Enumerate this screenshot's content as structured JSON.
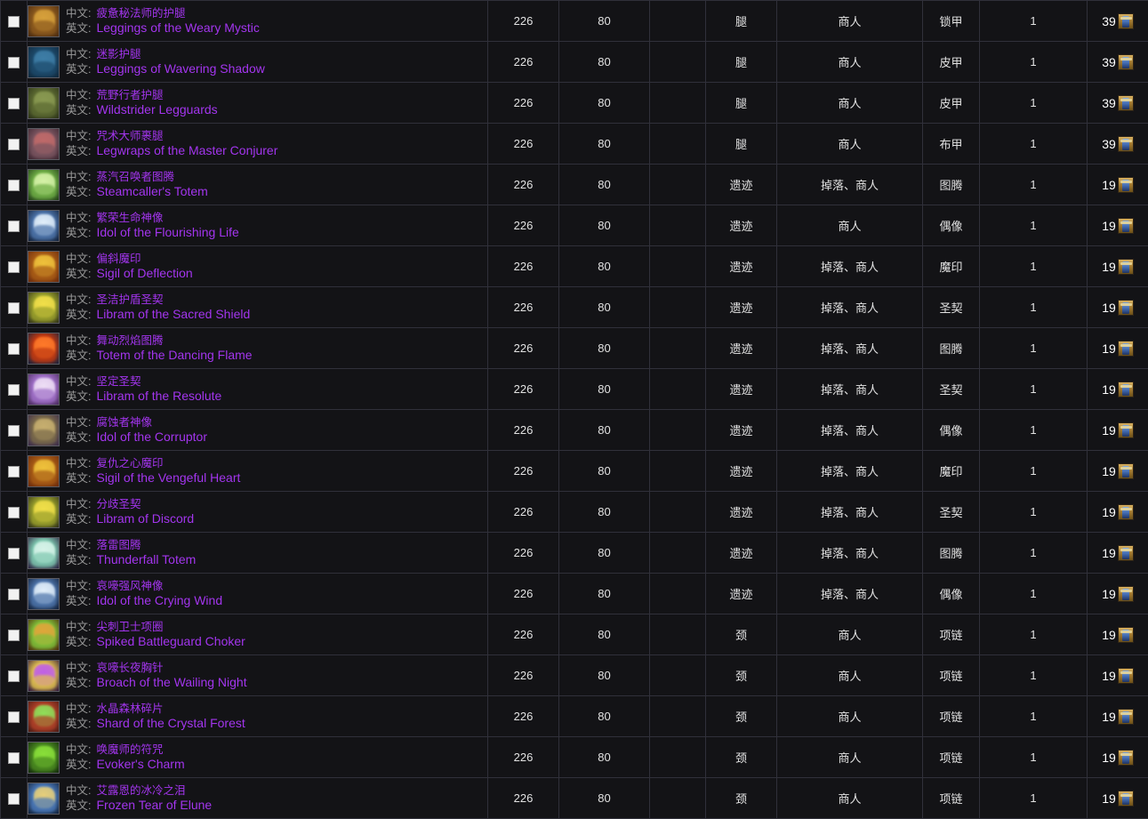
{
  "table": {
    "lang_labels": {
      "cn": "中文:",
      "en": "英文:"
    },
    "icon_names": {
      "checkbox": "row-checkbox",
      "item": "item-icon",
      "token": "emblem-token-icon"
    },
    "colors": {
      "epic_purple": "#a335ee",
      "label_gray": "#9a9a9a",
      "cell_text": "#e8e8e8",
      "row_bg": "#131316",
      "grid_line": "#30303a"
    },
    "rows": [
      {
        "name_cn": "疲惫秘法师的护腿",
        "name_en": "Leggings of the Weary Mystic",
        "ilvl": "226",
        "req_level": "80",
        "extra": "",
        "slot": "腿",
        "source": "商人",
        "armor": "锁甲",
        "qty": "1",
        "cost": "39",
        "icon_colors": [
          "#4a2a10",
          "#d8a23c",
          "#8c5a1e"
        ]
      },
      {
        "name_cn": "迷影护腿",
        "name_en": "Leggings of Wavering Shadow",
        "ilvl": "226",
        "req_level": "80",
        "extra": "",
        "slot": "腿",
        "source": "商人",
        "armor": "皮甲",
        "qty": "1",
        "cost": "39",
        "icon_colors": [
          "#10283c",
          "#3f7fa8",
          "#1d4a6b"
        ]
      },
      {
        "name_cn": "荒野行者护腿",
        "name_en": "Wildstrider Legguards",
        "ilvl": "226",
        "req_level": "80",
        "extra": "",
        "slot": "腿",
        "source": "商人",
        "armor": "皮甲",
        "qty": "1",
        "cost": "39",
        "icon_colors": [
          "#2c3318",
          "#8a9a52",
          "#5c6a32"
        ]
      },
      {
        "name_cn": "咒术大师裹腿",
        "name_en": "Legwraps of the Master Conjurer",
        "ilvl": "226",
        "req_level": "80",
        "extra": "",
        "slot": "腿",
        "source": "商人",
        "armor": "布甲",
        "qty": "1",
        "cost": "39",
        "icon_colors": [
          "#3b2530",
          "#c06a6a",
          "#7a5560"
        ]
      },
      {
        "name_cn": "蒸汽召唤者图腾",
        "name_en": "Steamcaller's Totem",
        "ilvl": "226",
        "req_level": "80",
        "extra": "",
        "slot": "遗迹",
        "source": "掉落、商人",
        "armor": "图腾",
        "qty": "1",
        "cost": "19",
        "icon_colors": [
          "#1e3a16",
          "#d6f2a8",
          "#6fae46"
        ]
      },
      {
        "name_cn": "繁荣生命神像",
        "name_en": "Idol of the Flourishing Life",
        "ilvl": "226",
        "req_level": "80",
        "extra": "",
        "slot": "遗迹",
        "source": "商人",
        "armor": "偶像",
        "qty": "1",
        "cost": "19",
        "icon_colors": [
          "#101e36",
          "#e3f0fb",
          "#4d74aa"
        ]
      },
      {
        "name_cn": "偏斜魔印",
        "name_en": "Sigil of Deflection",
        "ilvl": "226",
        "req_level": "80",
        "extra": "",
        "slot": "遗迹",
        "source": "掉落、商人",
        "armor": "魔印",
        "qty": "1",
        "cost": "19",
        "icon_colors": [
          "#6b2a0c",
          "#f0c33c",
          "#a85c16"
        ]
      },
      {
        "name_cn": "圣洁护盾圣契",
        "name_en": "Libram of the Sacred Shield",
        "ilvl": "226",
        "req_level": "80",
        "extra": "",
        "slot": "遗迹",
        "source": "掉落、商人",
        "armor": "圣契",
        "qty": "1",
        "cost": "19",
        "icon_colors": [
          "#2e3018",
          "#f2e04a",
          "#9aa02c"
        ]
      },
      {
        "name_cn": "舞动烈焰图腾",
        "name_en": "Totem of the Dancing Flame",
        "ilvl": "226",
        "req_level": "80",
        "extra": "",
        "slot": "遗迹",
        "source": "掉落、商人",
        "armor": "图腾",
        "qty": "1",
        "cost": "19",
        "icon_colors": [
          "#14203c",
          "#ff7a2a",
          "#c03a12"
        ]
      },
      {
        "name_cn": "坚定圣契",
        "name_en": "Libram of the Resolute",
        "ilvl": "226",
        "req_level": "80",
        "extra": "",
        "slot": "遗迹",
        "source": "掉落、商人",
        "armor": "圣契",
        "qty": "1",
        "cost": "19",
        "icon_colors": [
          "#4a2a5e",
          "#efe0f6",
          "#a070c8"
        ]
      },
      {
        "name_cn": "腐蚀者神像",
        "name_en": "Idol of the Corruptor",
        "ilvl": "226",
        "req_level": "80",
        "extra": "",
        "slot": "遗迹",
        "source": "掉落、商人",
        "armor": "偶像",
        "qty": "1",
        "cost": "19",
        "icon_colors": [
          "#3a2a4a",
          "#c8b070",
          "#7a6a4a"
        ]
      },
      {
        "name_cn": "复仇之心魔印",
        "name_en": "Sigil of the Vengeful Heart",
        "ilvl": "226",
        "req_level": "80",
        "extra": "",
        "slot": "遗迹",
        "source": "掉落、商人",
        "armor": "魔印",
        "qty": "1",
        "cost": "19",
        "icon_colors": [
          "#6b2a0c",
          "#f0c33c",
          "#a85c16"
        ]
      },
      {
        "name_cn": "分歧圣契",
        "name_en": "Libram of Discord",
        "ilvl": "226",
        "req_level": "80",
        "extra": "",
        "slot": "遗迹",
        "source": "掉落、商人",
        "armor": "圣契",
        "qty": "1",
        "cost": "19",
        "icon_colors": [
          "#2e3018",
          "#f2e04a",
          "#9aa02c"
        ]
      },
      {
        "name_cn": "落雷图腾",
        "name_en": "Thunderfall Totem",
        "ilvl": "226",
        "req_level": "80",
        "extra": "",
        "slot": "遗迹",
        "source": "掉落、商人",
        "armor": "图腾",
        "qty": "1",
        "cost": "19",
        "icon_colors": [
          "#2a1e3e",
          "#d8f4ea",
          "#7fc8b0"
        ]
      },
      {
        "name_cn": "哀嚎强风神像",
        "name_en": "Idol of the Crying Wind",
        "ilvl": "226",
        "req_level": "80",
        "extra": "",
        "slot": "遗迹",
        "source": "掉落、商人",
        "armor": "偶像",
        "qty": "1",
        "cost": "19",
        "icon_colors": [
          "#101e36",
          "#e3f0fb",
          "#4d74aa"
        ]
      },
      {
        "name_cn": "尖刺卫士项圈",
        "name_en": "Spiked Battleguard Choker",
        "ilvl": "226",
        "req_level": "80",
        "extra": "",
        "slot": "颈",
        "source": "商人",
        "armor": "项链",
        "qty": "1",
        "cost": "19",
        "icon_colors": [
          "#4a2408",
          "#e0a63a",
          "#7fc03a"
        ]
      },
      {
        "name_cn": "哀嚎长夜胸针",
        "name_en": "Broach of the Wailing Night",
        "ilvl": "226",
        "req_level": "80",
        "extra": "",
        "slot": "颈",
        "source": "商人",
        "armor": "项链",
        "qty": "1",
        "cost": "19",
        "icon_colors": [
          "#2a1038",
          "#c060e8",
          "#e0c050"
        ]
      },
      {
        "name_cn": "水晶森林碎片",
        "name_en": "Shard of the Crystal Forest",
        "ilvl": "226",
        "req_level": "80",
        "extra": "",
        "slot": "颈",
        "source": "商人",
        "armor": "项链",
        "qty": "1",
        "cost": "19",
        "icon_colors": [
          "#4a1a14",
          "#8fe05a",
          "#b04028"
        ]
      },
      {
        "name_cn": "唤魔师的符咒",
        "name_en": "Evoker's Charm",
        "ilvl": "226",
        "req_level": "80",
        "extra": "",
        "slot": "颈",
        "source": "商人",
        "armor": "项链",
        "qty": "1",
        "cost": "19",
        "icon_colors": [
          "#12280c",
          "#8ae03a",
          "#4a8a20"
        ]
      },
      {
        "name_cn": "艾露恩的冰冷之泪",
        "name_en": "Frozen Tear of Elune",
        "ilvl": "226",
        "req_level": "80",
        "extra": "",
        "slot": "颈",
        "source": "商人",
        "armor": "项链",
        "qty": "1",
        "cost": "19",
        "icon_colors": [
          "#102038",
          "#e8d07a",
          "#4a78b8"
        ]
      }
    ]
  }
}
